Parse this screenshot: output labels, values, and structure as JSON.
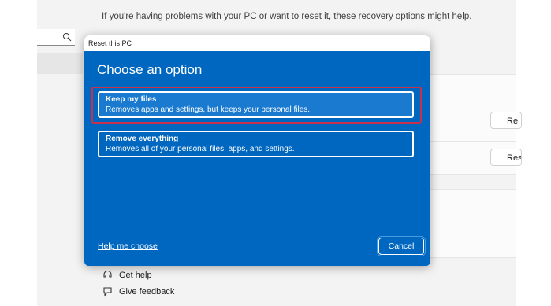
{
  "settings": {
    "subtitle": "If you're having problems with your PC or want to reset it, these recovery options might help.",
    "side_buttons": [
      "Re",
      "Res"
    ],
    "bottom_links": [
      {
        "label": "Get help",
        "icon": "help-icon"
      },
      {
        "label": "Give feedback",
        "icon": "feedback-icon"
      }
    ]
  },
  "dialog": {
    "window_title": "Reset this PC",
    "heading": "Choose an option",
    "options": [
      {
        "title": "Keep my files",
        "description": "Removes apps and settings, but keeps your personal files."
      },
      {
        "title": "Remove everything",
        "description": "Removes all of your personal files, apps, and settings."
      }
    ],
    "help_link": "Help me choose",
    "cancel_label": "Cancel"
  },
  "colors": {
    "dialog_blue": "#0067c0",
    "highlight": "#c8304c"
  }
}
